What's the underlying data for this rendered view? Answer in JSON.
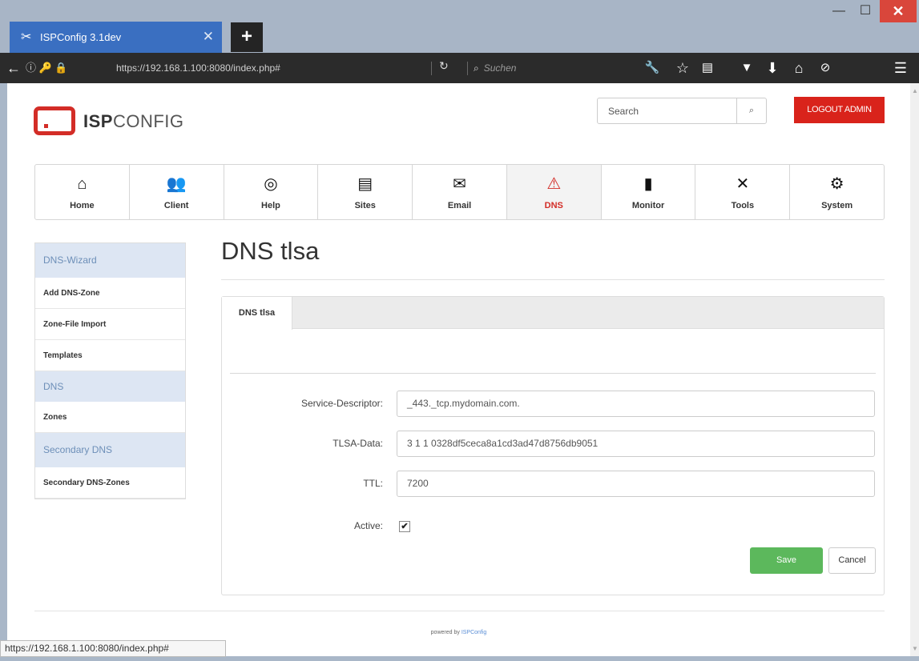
{
  "browser": {
    "tab_title": "ISPConfig 3.1dev",
    "tab_close": "✕",
    "new_tab": "+",
    "url": "https://192.168.1.100:8080/index.php#",
    "search_placeholder": "Suchen",
    "status_url": "https://192.168.1.100:8080/index.php#",
    "window_buttons": {
      "minimize": "—",
      "maximize": "☐",
      "close": "✕"
    }
  },
  "header": {
    "logo_bold": "ISP",
    "logo_light": "CONFIG",
    "search_placeholder": "Search",
    "logout_label": "LOGOUT ADMIN"
  },
  "main_nav": [
    {
      "label": "Home",
      "icon": "home-icon",
      "glyph": "⌂"
    },
    {
      "label": "Client",
      "icon": "users-icon",
      "glyph": "👥"
    },
    {
      "label": "Help",
      "icon": "lifebuoy-icon",
      "glyph": "◎"
    },
    {
      "label": "Sites",
      "icon": "sites-icon",
      "glyph": "▤"
    },
    {
      "label": "Email",
      "icon": "email-icon",
      "glyph": "✉"
    },
    {
      "label": "DNS",
      "icon": "dns-icon",
      "glyph": "⚠",
      "active": true
    },
    {
      "label": "Monitor",
      "icon": "monitor-icon",
      "glyph": "▮"
    },
    {
      "label": "Tools",
      "icon": "tools-icon",
      "glyph": "✕"
    },
    {
      "label": "System",
      "icon": "gear-icon",
      "glyph": "⚙"
    }
  ],
  "sidebar": {
    "sections": [
      {
        "title": "DNS-Wizard",
        "items": [
          "Add DNS-Zone",
          "Zone-File Import",
          "Templates"
        ]
      },
      {
        "title": "DNS",
        "items": [
          "Zones"
        ]
      },
      {
        "title": "Secondary DNS",
        "items": [
          "Secondary DNS-Zones"
        ]
      }
    ]
  },
  "content": {
    "page_title": "DNS tlsa",
    "tab_label": "DNS tlsa",
    "fields": {
      "service_descriptor": {
        "label": "Service-Descriptor:",
        "value": "_443._tcp.mydomain.com."
      },
      "tlsa_data": {
        "label": "TLSA-Data:",
        "value": "3 1 1 0328df5ceca8a1cd3ad47d8756db9051"
      },
      "ttl": {
        "label": "TTL:",
        "value": "7200"
      },
      "active": {
        "label": "Active:",
        "checked": true
      }
    },
    "save_label": "Save",
    "cancel_label": "Cancel"
  },
  "footer": {
    "powered_prefix": "powered by",
    "powered_link": "ISPConfig"
  }
}
